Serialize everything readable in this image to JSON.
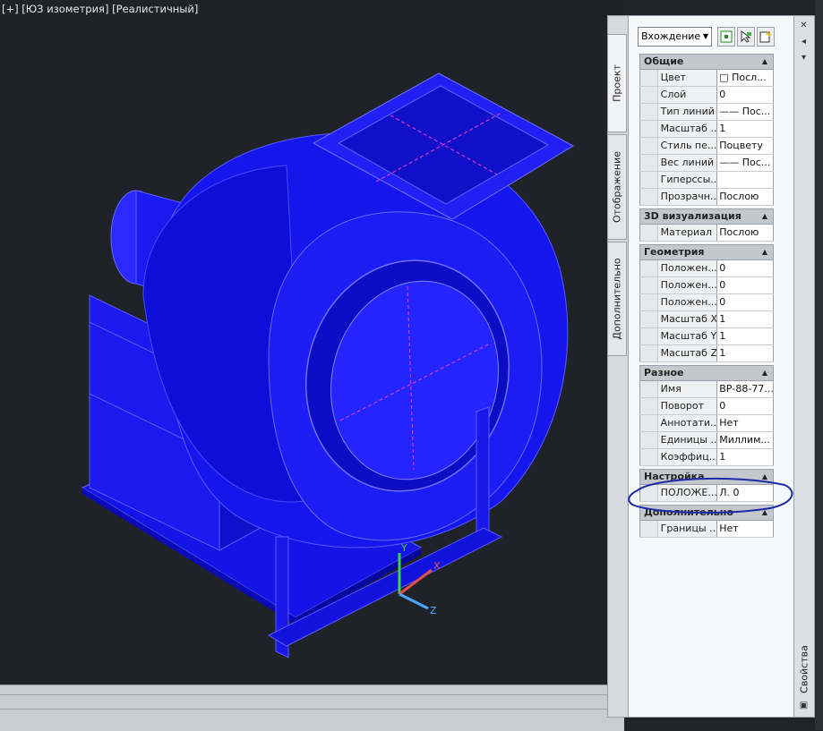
{
  "viewport": {
    "label": "[+] [ЮЗ изометрия] [Реалистичный]",
    "axes": {
      "x": "X",
      "y": "Y",
      "z": "Z"
    },
    "model_color": "#0b0bef"
  },
  "palette": {
    "title": "Свойства",
    "tabs": [
      "Проект",
      "Отображение",
      "Дополнительно"
    ],
    "dropdown_value": "Вхождение",
    "sections": [
      {
        "title": "Общие",
        "rows": [
          {
            "name": "Цвет",
            "value": "□ Посл..."
          },
          {
            "name": "Слой",
            "value": "0"
          },
          {
            "name": "Тип линий",
            "value": "—— Пос..."
          },
          {
            "name": "Масштаб ...",
            "value": "1"
          },
          {
            "name": "Стиль пе...",
            "value": "Поцвету"
          },
          {
            "name": "Вес линий",
            "value": "—— Пос..."
          },
          {
            "name": "Гиперссы...",
            "value": ""
          },
          {
            "name": "Прозрачн...",
            "value": "Послою"
          }
        ]
      },
      {
        "title": "3D визуализация",
        "rows": [
          {
            "name": "Материал",
            "value": "Послою"
          }
        ]
      },
      {
        "title": "Геометрия",
        "rows": [
          {
            "name": "Положен...",
            "value": "0"
          },
          {
            "name": "Положен...",
            "value": "0"
          },
          {
            "name": "Положен...",
            "value": "0"
          },
          {
            "name": "Масштаб X",
            "value": "1"
          },
          {
            "name": "Масштаб Y",
            "value": "1"
          },
          {
            "name": "Масштаб Z",
            "value": "1"
          }
        ]
      },
      {
        "title": "Разное",
        "rows": [
          {
            "name": "Имя",
            "value": "ВР-88-77..."
          },
          {
            "name": "Поворот",
            "value": "0"
          },
          {
            "name": "Аннотати...",
            "value": "Нет"
          },
          {
            "name": "Единицы ...",
            "value": "Миллим..."
          },
          {
            "name": "Коэффиц...",
            "value": "1"
          }
        ]
      },
      {
        "title": "Настройка",
        "rows": [
          {
            "name": "ПОЛОЖЕ...",
            "value": "Л. 0"
          }
        ]
      },
      {
        "title": "Дополнительно",
        "rows": [
          {
            "name": "Границы ...",
            "value": "Нет"
          }
        ]
      }
    ]
  }
}
